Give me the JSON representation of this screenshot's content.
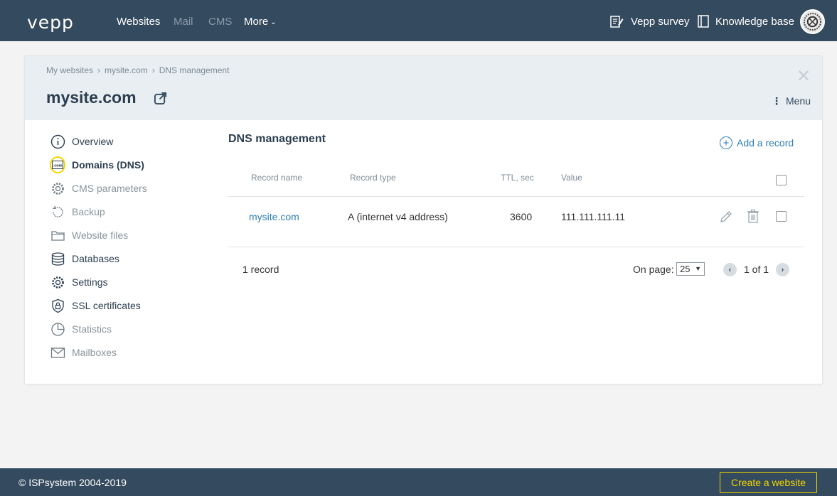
{
  "header": {
    "logo": "vepp",
    "nav": [
      {
        "label": "Websites"
      },
      {
        "label": "Mail"
      },
      {
        "label": "CMS"
      },
      {
        "label": "More"
      }
    ],
    "survey_label": "Vepp survey",
    "kb_label": "Knowledge base"
  },
  "breadcrumb": [
    "My websites",
    "mysite.com",
    "DNS management"
  ],
  "site_title": "mysite.com",
  "menu_label": "Menu",
  "sidebar": {
    "items": [
      {
        "label": "Overview",
        "icon": "info-icon"
      },
      {
        "label": "Domains (DNS)",
        "icon": "domain-icon",
        "active": true
      },
      {
        "label": "CMS parameters",
        "icon": "gear-icon"
      },
      {
        "label": "Backup",
        "icon": "backup-icon"
      },
      {
        "label": "Website files",
        "icon": "folder-icon"
      },
      {
        "label": "Databases",
        "icon": "database-icon"
      },
      {
        "label": "Settings",
        "icon": "gear-icon"
      },
      {
        "label": "SSL certificates",
        "icon": "lock-shield-icon"
      },
      {
        "label": "Statistics",
        "icon": "pie-chart-icon"
      },
      {
        "label": "Mailboxes",
        "icon": "envelope-icon"
      }
    ]
  },
  "dns": {
    "title": "DNS management",
    "add_label": "Add a record",
    "columns": [
      "Record name",
      "Record type",
      "TTL, sec",
      "Value"
    ],
    "rows": [
      {
        "name": "mysite.com",
        "type": "A (internet v4 address)",
        "ttl": "3600",
        "value": "111.111.111.11"
      }
    ],
    "count_label": "1 record",
    "on_page_label": "On page:",
    "page_size": "25",
    "page_info": "1 of 1"
  },
  "footer": {
    "copyright": "© ISPsystem 2004-2019",
    "create_label": "Create a website"
  },
  "colors": {
    "topbar": "#344a5e",
    "accent_link": "#2f7fb8",
    "active_ring": "#f2d600"
  }
}
